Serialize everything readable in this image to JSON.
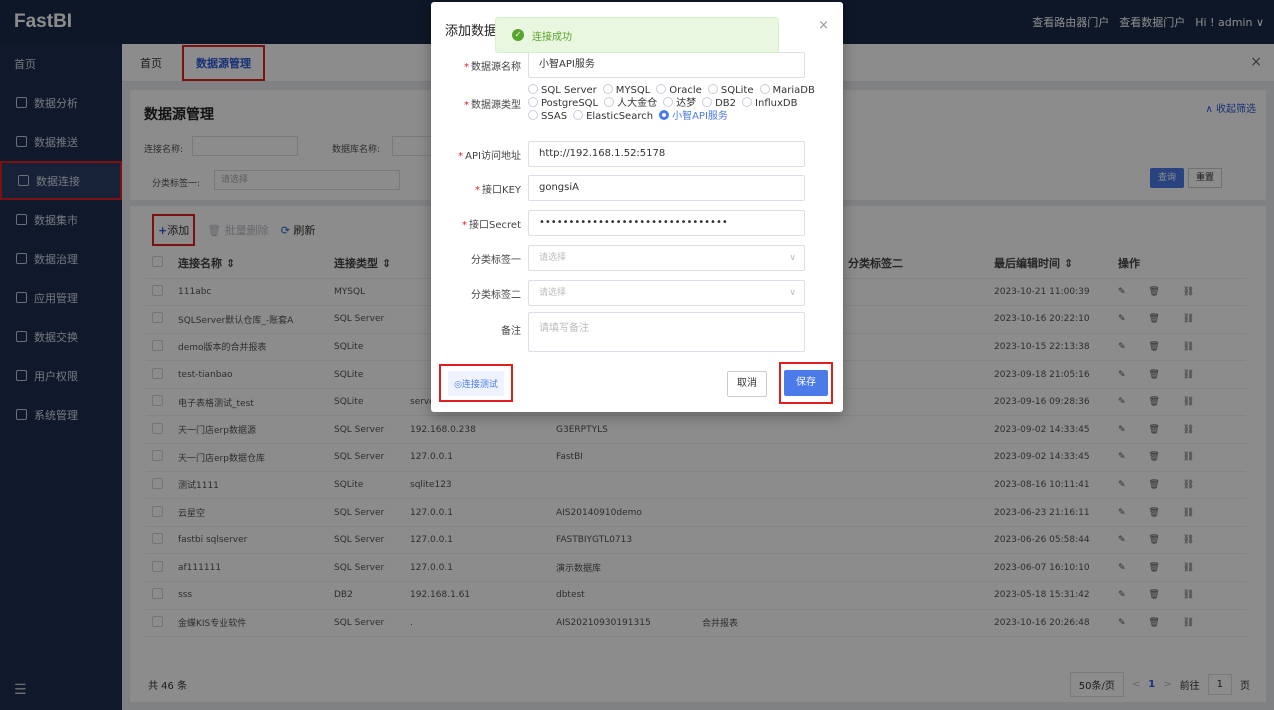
{
  "app": {
    "logo": "FastBI"
  },
  "topbar": {
    "link1": "查看路由器门户",
    "link2": "查看数据门户",
    "user": "Hi ! admin ∨"
  },
  "sidebar": {
    "home": "首页",
    "items": [
      {
        "label": "数据分析",
        "icon": "chart-icon"
      },
      {
        "label": "数据推送",
        "icon": "push-icon"
      },
      {
        "label": "数据连接",
        "icon": "connection-icon"
      },
      {
        "label": "数据集市",
        "icon": "dataset-icon"
      },
      {
        "label": "数据治理",
        "icon": "governance-icon"
      },
      {
        "label": "应用管理",
        "icon": "apps-icon"
      },
      {
        "label": "数据交换",
        "icon": "exchange-icon"
      },
      {
        "label": "用户权限",
        "icon": "user-icon"
      },
      {
        "label": "系统管理",
        "icon": "settings-icon"
      }
    ],
    "collapse": "☰"
  },
  "tabs": {
    "home": "首页",
    "active": "数据源管理",
    "close": "×"
  },
  "page": {
    "title": "数据源管理",
    "collapse_filter": "∧ 收起筛选",
    "filter_conn_label": "连接名称:",
    "filter_db_label": "数据库名称:",
    "filter_tag_label": "分类标签一:",
    "filter_tag_placeholder": "请选择",
    "query": "查询",
    "reset": "重置"
  },
  "toolbar": {
    "add": "添加",
    "batch_delete": "批量删除",
    "refresh": "刷新"
  },
  "table": {
    "headers": [
      "连接名称 ⇕",
      "连接类型 ⇕",
      "",
      "",
      "分类标签二",
      "最后编辑时间 ⇕",
      "操作"
    ],
    "rows": [
      [
        "111abc",
        "MYSQL",
        "",
        "",
        "",
        "2023-10-21 11:00:39"
      ],
      [
        "SQLServer默认仓库_-账套A",
        "SQL Server",
        "",
        "",
        "",
        "2023-10-16 20:22:10"
      ],
      [
        "demo版本的合并报表",
        "SQLite",
        "",
        "",
        "",
        "2023-10-15 22:13:38"
      ],
      [
        "test-tianbao",
        "SQLite",
        "",
        "",
        "",
        "2023-09-18 21:05:16"
      ],
      [
        "电子表格测试_test",
        "SQLite",
        "server47.db",
        "",
        "",
        "2023-09-16 09:28:36"
      ],
      [
        "天一门店erp数据源",
        "SQL Server",
        "192.168.0.238",
        "G3ERPTYLS",
        "",
        "2023-09-02 14:33:45"
      ],
      [
        "天一门店erp数据仓库",
        "SQL Server",
        "127.0.0.1",
        "FastBI",
        "",
        "2023-09-02 14:33:45"
      ],
      [
        "测试1111",
        "SQLite",
        "sqlite123",
        "",
        "",
        "2023-08-16 10:11:41"
      ],
      [
        "云星空",
        "SQL Server",
        "127.0.0.1",
        "AIS20140910demo",
        "",
        "2023-06-23 21:16:11"
      ],
      [
        "fastbi sqlserver",
        "SQL Server",
        "127.0.0.1",
        "FASTBIYGTL0713",
        "",
        "2023-06-26 05:58:44"
      ],
      [
        "af111111",
        "SQL Server",
        "127.0.0.1",
        "演示数据库",
        "",
        "2023-06-07 16:10:10"
      ],
      [
        "sss",
        "DB2",
        "192.168.1.61",
        "dbtest",
        "",
        "2023-05-18 15:31:42"
      ],
      [
        "金蝶KIS专业软件",
        "SQL Server",
        ".",
        "AIS20210930191315",
        "合并报表",
        "2023-10-16 20:26:48"
      ]
    ],
    "ops": "✎ 🗑 ⛓"
  },
  "footer": {
    "total": "共 46 条",
    "page_size": "50条/页",
    "prev": "<",
    "page": "1",
    "next": ">",
    "goto": "前往",
    "goto_page": "1",
    "page_unit": "页"
  },
  "dialog": {
    "title": "添加数据",
    "close": "×",
    "name_label": "数据源名称",
    "name_value": "小智API服务",
    "type_label": "数据源类型",
    "types": [
      "SQL Server",
      "MYSQL",
      "Oracle",
      "SQLite",
      "MariaDB",
      "PostgreSQL",
      "人大金仓",
      "达梦",
      "DB2",
      "InfluxDB",
      "SSAS",
      "ElasticSearch",
      "小智API服务"
    ],
    "selected_type": "小智API服务",
    "url_label": "API访问地址",
    "url_value": "http://192.168.1.52:5178",
    "key_label": "接口KEY",
    "key_value": "gongsiA",
    "secret_label": "接口Secret",
    "secret_value": "••••••••••••••••••••••••••••••••",
    "tag1_label": "分类标签一",
    "tag2_label": "分类标签二",
    "select_placeholder": "请选择",
    "remark_label": "备注",
    "remark_placeholder": "请填写备注",
    "test_button": "◎连接测试",
    "cancel": "取消",
    "save": "保存"
  },
  "toast": {
    "message": "连接成功"
  }
}
